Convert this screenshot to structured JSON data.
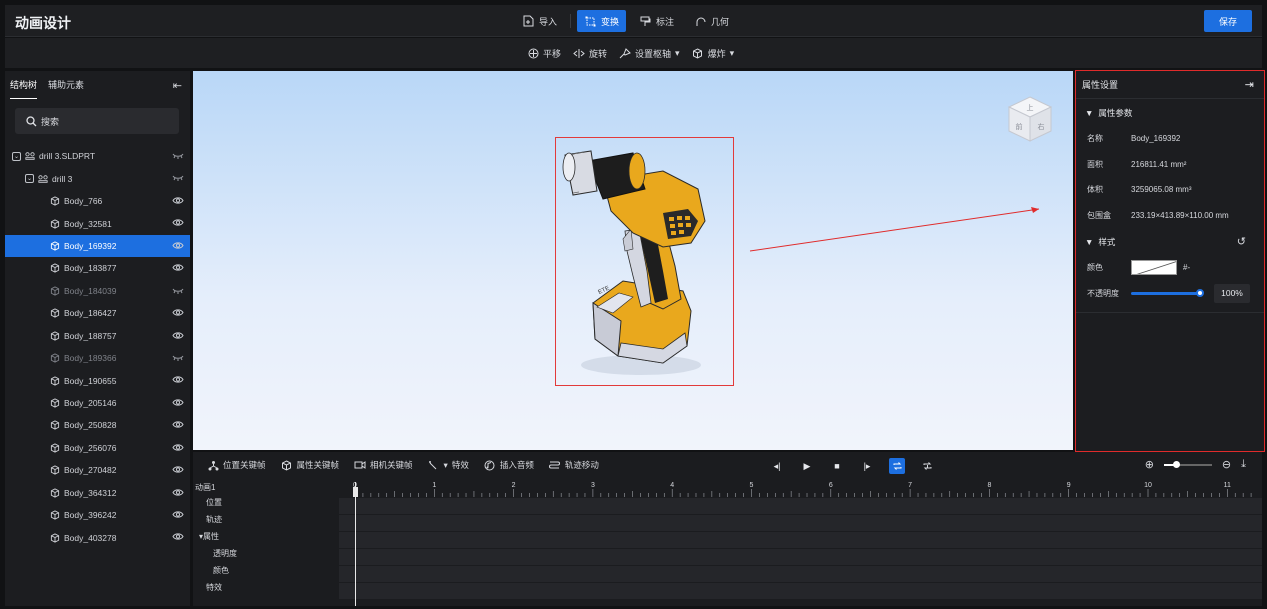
{
  "app": {
    "title": "动画设计",
    "save_label": "保存"
  },
  "toolbar": {
    "import_label": "导入",
    "transform_label": "变换",
    "annotate_label": "标注",
    "geometry_label": "几何"
  },
  "subtoolbar": {
    "translate_label": "平移",
    "rotate_label": "旋转",
    "pivot_label": "设置枢轴",
    "explode_label": "爆炸"
  },
  "left_panel": {
    "tab_tree": "结构树",
    "tab_aux": "辅助元素",
    "search_placeholder": "搜索",
    "tree": [
      {
        "label": "drill 3.SLDPRT",
        "level": 0,
        "visible": false,
        "dim": false
      },
      {
        "label": "drill 3",
        "level": 1,
        "visible": false,
        "dim": false
      },
      {
        "label": "Body_766",
        "level": 2,
        "visible": true,
        "dim": false
      },
      {
        "label": "Body_32581",
        "level": 2,
        "visible": true,
        "dim": false
      },
      {
        "label": "Body_169392",
        "level": 2,
        "visible": true,
        "dim": false,
        "selected": true
      },
      {
        "label": "Body_183877",
        "level": 2,
        "visible": true,
        "dim": false
      },
      {
        "label": "Body_184039",
        "level": 2,
        "visible": false,
        "dim": true
      },
      {
        "label": "Body_186427",
        "level": 2,
        "visible": true,
        "dim": false
      },
      {
        "label": "Body_188757",
        "level": 2,
        "visible": true,
        "dim": false
      },
      {
        "label": "Body_189366",
        "level": 2,
        "visible": false,
        "dim": true
      },
      {
        "label": "Body_190655",
        "level": 2,
        "visible": true,
        "dim": false
      },
      {
        "label": "Body_205146",
        "level": 2,
        "visible": true,
        "dim": false
      },
      {
        "label": "Body_250828",
        "level": 2,
        "visible": true,
        "dim": false
      },
      {
        "label": "Body_256076",
        "level": 2,
        "visible": true,
        "dim": false
      },
      {
        "label": "Body_270482",
        "level": 2,
        "visible": true,
        "dim": false
      },
      {
        "label": "Body_364312",
        "level": 2,
        "visible": true,
        "dim": false
      },
      {
        "label": "Body_396242",
        "level": 2,
        "visible": true,
        "dim": false
      },
      {
        "label": "Body_403278",
        "level": 2,
        "visible": true,
        "dim": false
      }
    ]
  },
  "viewcube": {
    "top": "上",
    "front": "前",
    "right": "右"
  },
  "product_label": "ETE",
  "properties": {
    "title": "属性设置",
    "section_params": "属性参数",
    "name_label": "名称",
    "name_value": "Body_169392",
    "area_label": "面积",
    "area_value": "216811.41 mm²",
    "volume_label": "体积",
    "volume_value": "3259065.08 mm³",
    "bbox_label": "包围盒",
    "bbox_value": "233.19×413.89×110.00 mm",
    "section_style": "样式",
    "color_label": "颜色",
    "color_value": "#-",
    "opacity_label": "不透明度",
    "opacity_value": "100%",
    "opacity_level": 1.0
  },
  "timeline": {
    "position_kf": "位置关键帧",
    "property_kf": "属性关键帧",
    "camera_kf": "相机关键帧",
    "effects": "特效",
    "insert_audio": "插入音频",
    "track_move": "轨迹移动",
    "animation_name": "动画1",
    "tracks": [
      "位置",
      "轨迹",
      "▾属性",
      "透明度",
      "颜色",
      "特效"
    ],
    "ticks": [
      "0",
      "1",
      "2",
      "3",
      "4",
      "5",
      "6",
      "7",
      "8",
      "9",
      "10",
      "11"
    ]
  }
}
